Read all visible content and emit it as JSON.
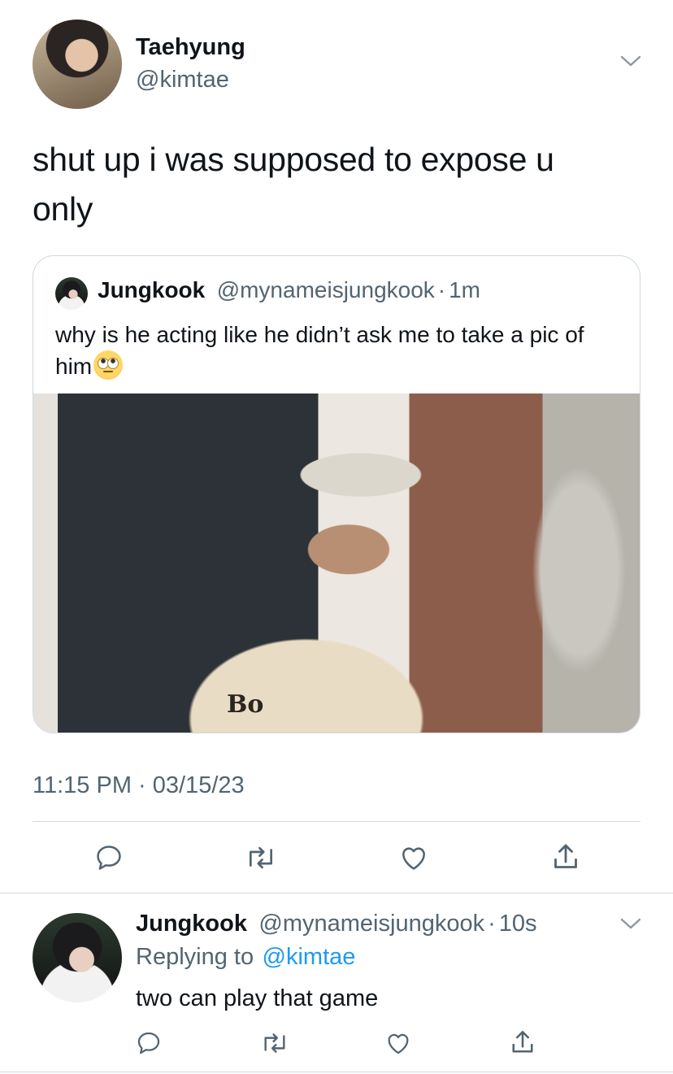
{
  "main_tweet": {
    "author_name": "Taehyung",
    "author_handle": "@kimtae",
    "text": "shut up i was supposed to expose u only",
    "timestamp": "11:15 PM · 03/15/23"
  },
  "quoted_tweet": {
    "author_name": "Jungkook",
    "author_handle": "@mynameisjungkook",
    "separator": "·",
    "age": "1m",
    "text": "why is he acting like he didn’t ask me to take a pic of him",
    "emoji": "face-with-rolling-eyes",
    "photo_shirt_text": "Bo"
  },
  "actions": [
    "reply-icon",
    "retweet-icon",
    "like-icon",
    "share-icon"
  ],
  "reply": {
    "author_name": "Jungkook",
    "author_handle": "@mynameisjungkook",
    "separator": "·",
    "age": "10s",
    "replying_to_label": "Replying to",
    "replying_to_handle": "@kimtae",
    "text": "two can play that game"
  },
  "colors": {
    "primary_text": "#0f1419",
    "secondary_text": "#536471",
    "link": "#1d9bf0",
    "border": "#cfd9de"
  }
}
